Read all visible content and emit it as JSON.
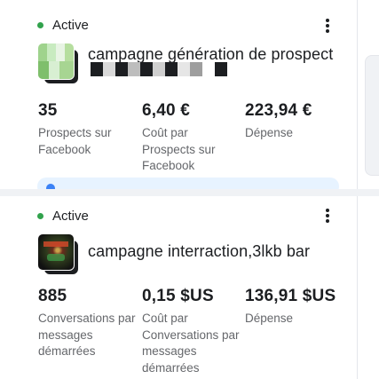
{
  "campaigns": [
    {
      "status": "Active",
      "title": "campagne génération de prospect",
      "metrics": [
        {
          "value": "35",
          "label": "Prospects sur Facebook"
        },
        {
          "value": "6,40 €",
          "label": "Coût par Prospects sur Facebook"
        },
        {
          "value": "223,94 €",
          "label": "Dépense"
        }
      ]
    },
    {
      "status": "Active",
      "title": "campagne interraction,3lkb bar",
      "metrics": [
        {
          "value": "885",
          "label": "Conversations par messages démarrées"
        },
        {
          "value": "0,15 $US",
          "label": "Coût par Conversations par messages démarrées"
        },
        {
          "value": "136,91 $US",
          "label": "Dépense"
        }
      ]
    }
  ],
  "colors": {
    "active_dot": "#31a24c",
    "text_primary": "#1c1e21",
    "text_secondary": "#65676b",
    "info_strip": "#e7f3ff"
  },
  "icons": {
    "menu": "more-vertical-icon",
    "status": "status-dot-icon"
  }
}
